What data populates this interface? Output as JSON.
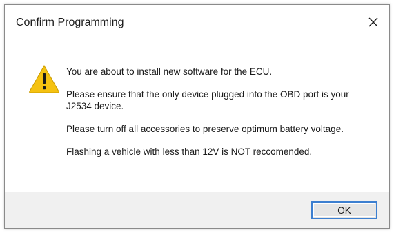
{
  "dialog": {
    "title": "Confirm Programming",
    "close_icon": "close-icon",
    "warning_icon": "warning-icon",
    "messages": [
      "You are about to install new software for the ECU.",
      "Please ensure that the only device plugged into the OBD port is your J2534 device.",
      "Please turn off all accessories to preserve optimum battery voltage.",
      "Flashing a vehicle with less than 12V is NOT reccomended."
    ],
    "ok_label": "OK"
  },
  "colors": {
    "warning_fill": "#f5c211",
    "focus_border": "#3c7fd0",
    "footer_bg": "#f0f0f0"
  }
}
